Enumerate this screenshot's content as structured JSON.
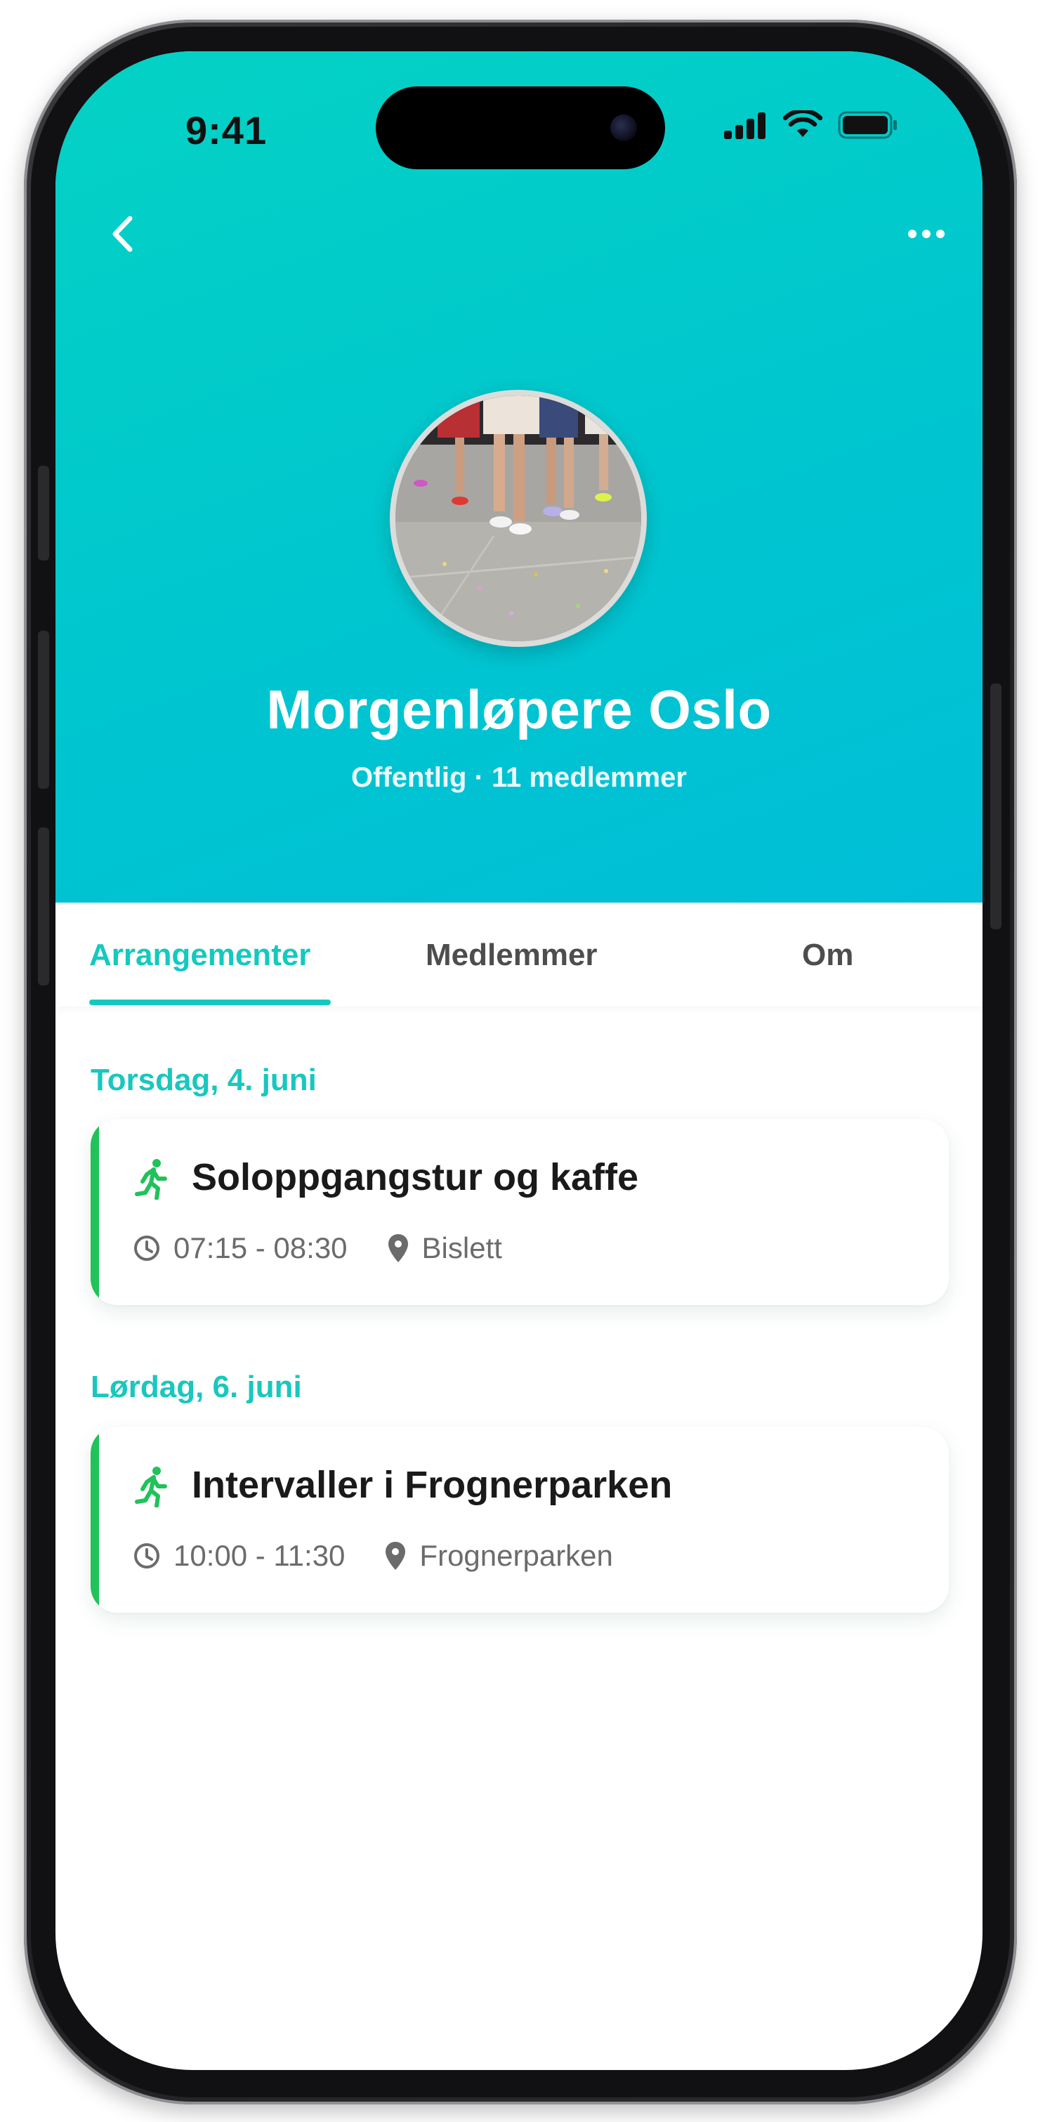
{
  "status_bar": {
    "time": "9:41"
  },
  "group": {
    "title": "Morgenløpere Oslo",
    "subtitle": "Offentlig · 11 medlemmer"
  },
  "tabs": [
    {
      "label": "Arrangementer",
      "active": true
    },
    {
      "label": "Medlemmer",
      "active": false
    },
    {
      "label": "Om",
      "active": false
    }
  ],
  "events": [
    {
      "day": "Torsdag, 4. juni",
      "title": "Soloppgangstur og kaffe",
      "time": "07:15 - 08:30",
      "location": "Bislett",
      "icon": "running-person-icon"
    },
    {
      "day": "Lørdag, 6. juni",
      "title": "Intervaller i Frognerparken",
      "time": "10:00 - 11:30",
      "location": "Frognerparken",
      "icon": "running-person-icon"
    }
  ],
  "colors": {
    "accent": "#14c9bf",
    "header_gradient_start": "#04d2c4",
    "header_gradient_end": "#00bed8",
    "event_bar": "#20c25a"
  }
}
